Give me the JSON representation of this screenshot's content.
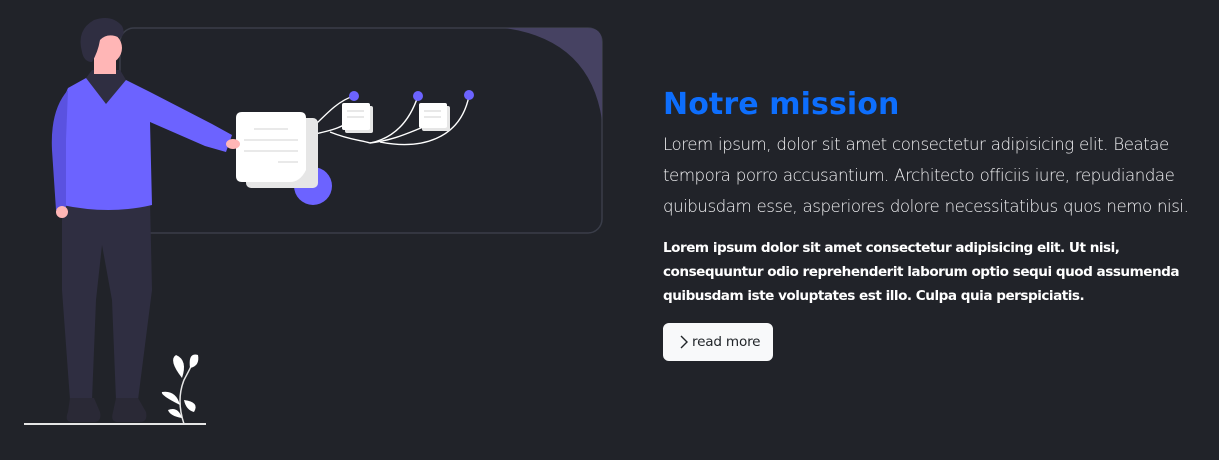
{
  "mission": {
    "title": "Notre mission",
    "lead": "Lorem ipsum, dolor sit amet consectetur adipisicing elit. Beatae tempora porro accusantium. Architecto officiis iure, repudiandae quibusdam esse, asperiores dolore necessitatibus quos nemo nisi.",
    "body": "Lorem ipsum dolor sit amet consectetur adipisicing elit. Ut nisi, consequuntur odio reprehenderit laborum optio sequi quod assumenda quibusdam iste voluptates est illo. Culpa quia perspiciatis.",
    "button_label": "read more",
    "button_icon": "chevron-right-icon"
  },
  "colors": {
    "background": "#212329",
    "title": "#0d6efd",
    "accent": "#6c63ff",
    "button_bg": "#f8f9fa"
  }
}
